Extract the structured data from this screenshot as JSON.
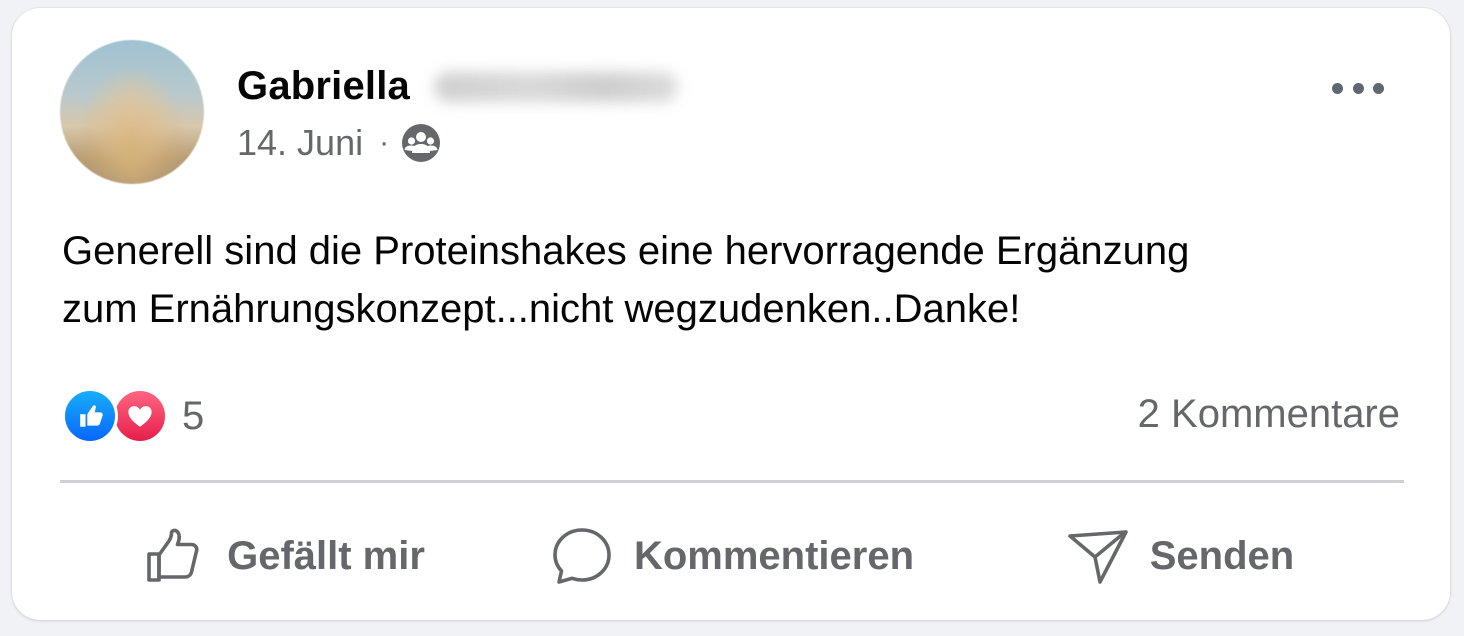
{
  "post": {
    "author_name": "Gabriella",
    "date": "14. Juni",
    "separator": "·",
    "audience_icon": "friends-group-icon",
    "more_icon": "more-horizontal-icon",
    "text": "Generell sind die Proteinshakes eine hervorragende Ergänzung\nzum Ernährungskonzept...nicht wegzudenken..Danke!"
  },
  "reactions": {
    "types": [
      "like",
      "love"
    ],
    "count": "5",
    "comments_label": "2 Kommentare"
  },
  "actions": {
    "like_label": "Gefällt mir",
    "comment_label": "Kommentieren",
    "send_label": "Senden"
  },
  "colors": {
    "text_primary": "#050505",
    "text_secondary": "#65676b",
    "like_blue": "#0866ff",
    "love_red": "#e61e4d",
    "divider": "#ced0d4"
  }
}
